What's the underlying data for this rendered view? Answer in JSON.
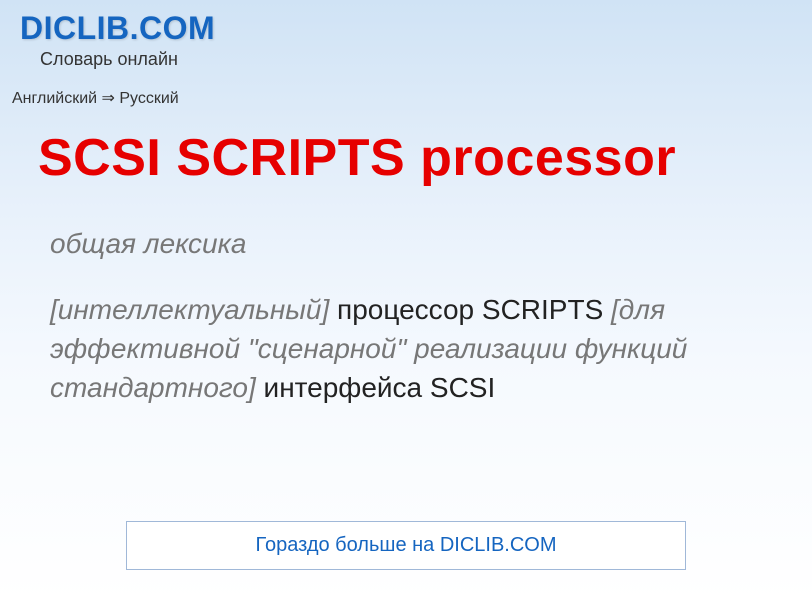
{
  "header": {
    "logo": "DICLIB.COM",
    "tagline": "Словарь онлайн"
  },
  "breadcrumb": {
    "text": "Английский ⇒ Русский"
  },
  "entry": {
    "title": "SCSI SCRIPTS processor",
    "category": "общая лексика",
    "definition": {
      "part1_italic": "[интеллектуальный] ",
      "part1_regular": "процессор SCRIPTS ",
      "part2_italic": "[для эффективной \"сценарной\" реализации функций стандартного] ",
      "part2_regular": "интерфейса SCSI"
    }
  },
  "cta": {
    "label": "Гораздо больше на DICLIB.COM"
  }
}
